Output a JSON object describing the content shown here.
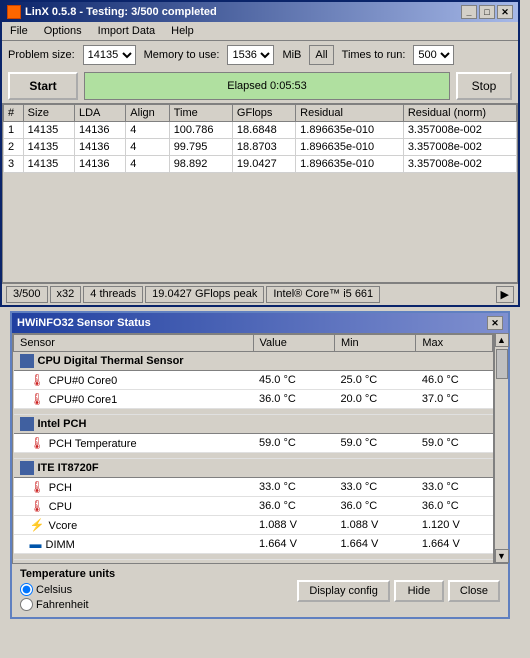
{
  "linx": {
    "title": "LinX 0.5.8 - Testing: 3/500 completed",
    "menu": [
      "File",
      "Options",
      "Import Data",
      "Help"
    ],
    "toolbar": {
      "problem_size_label": "Problem size:",
      "problem_size_value": "14135",
      "memory_label": "Memory to use:",
      "memory_value": "1536",
      "mib_label": "MiB",
      "all_label": "All",
      "times_label": "Times to run:",
      "times_value": "500"
    },
    "actions": {
      "start_label": "Start",
      "elapsed_label": "Elapsed 0:05:53",
      "stop_label": "Stop"
    },
    "table": {
      "headers": [
        "#",
        "Size",
        "LDA",
        "Align",
        "Time",
        "GFlops",
        "Residual",
        "Residual (norm)"
      ],
      "rows": [
        [
          "1",
          "14135",
          "14136",
          "4",
          "100.786",
          "18.6848",
          "1.896635e-010",
          "3.357008e-002"
        ],
        [
          "2",
          "14135",
          "14136",
          "4",
          "99.795",
          "18.8703",
          "1.896635e-010",
          "3.357008e-002"
        ],
        [
          "3",
          "14135",
          "14136",
          "4",
          "98.892",
          "19.0427",
          "1.896635e-010",
          "3.357008e-002"
        ]
      ]
    },
    "status": {
      "progress": "3/500",
      "multiplier": "x32",
      "threads": "4 threads",
      "gflops": "19.0427 GFlops peak",
      "cpu": "Intel® Core™ i5 661"
    }
  },
  "hwinfo": {
    "title": "HWiNFO32 Sensor Status",
    "table": {
      "headers": [
        "Sensor",
        "Value",
        "Min",
        "Max"
      ],
      "groups": [
        {
          "name": "CPU Digital Thermal Sensor",
          "icon": "chip",
          "rows": [
            {
              "sensor": "CPU#0 Core0",
              "value": "45.0 °C",
              "min": "25.0 °C",
              "max": "46.0 °C",
              "icon": "temp"
            },
            {
              "sensor": "CPU#0 Core1",
              "value": "36.0 °C",
              "min": "20.0 °C",
              "max": "37.0 °C",
              "icon": "temp"
            }
          ]
        },
        {
          "name": "Intel PCH",
          "icon": "chip",
          "rows": [
            {
              "sensor": "PCH Temperature",
              "value": "59.0 °C",
              "min": "59.0 °C",
              "max": "59.0 °C",
              "icon": "temp"
            }
          ]
        },
        {
          "name": "ITE IT8720F",
          "icon": "chip",
          "rows": [
            {
              "sensor": "PCH",
              "value": "33.0 °C",
              "min": "33.0 °C",
              "max": "33.0 °C",
              "icon": "temp"
            },
            {
              "sensor": "CPU",
              "value": "36.0 °C",
              "min": "36.0 °C",
              "max": "36.0 °C",
              "icon": "temp"
            },
            {
              "sensor": "Vcore",
              "value": "1.088 V",
              "min": "1.088 V",
              "max": "1.120 V",
              "icon": "volt"
            },
            {
              "sensor": "DIMM",
              "value": "1.664 V",
              "min": "1.664 V",
              "max": "1.664 V",
              "icon": "dimm"
            }
          ]
        }
      ]
    },
    "temp_units": {
      "label": "Temperature units",
      "celsius": "Celsius",
      "fahrenheit": "Fahrenheit",
      "selected": "celsius"
    },
    "buttons": {
      "display_config": "Display config",
      "hide": "Hide",
      "close": "Close"
    }
  }
}
